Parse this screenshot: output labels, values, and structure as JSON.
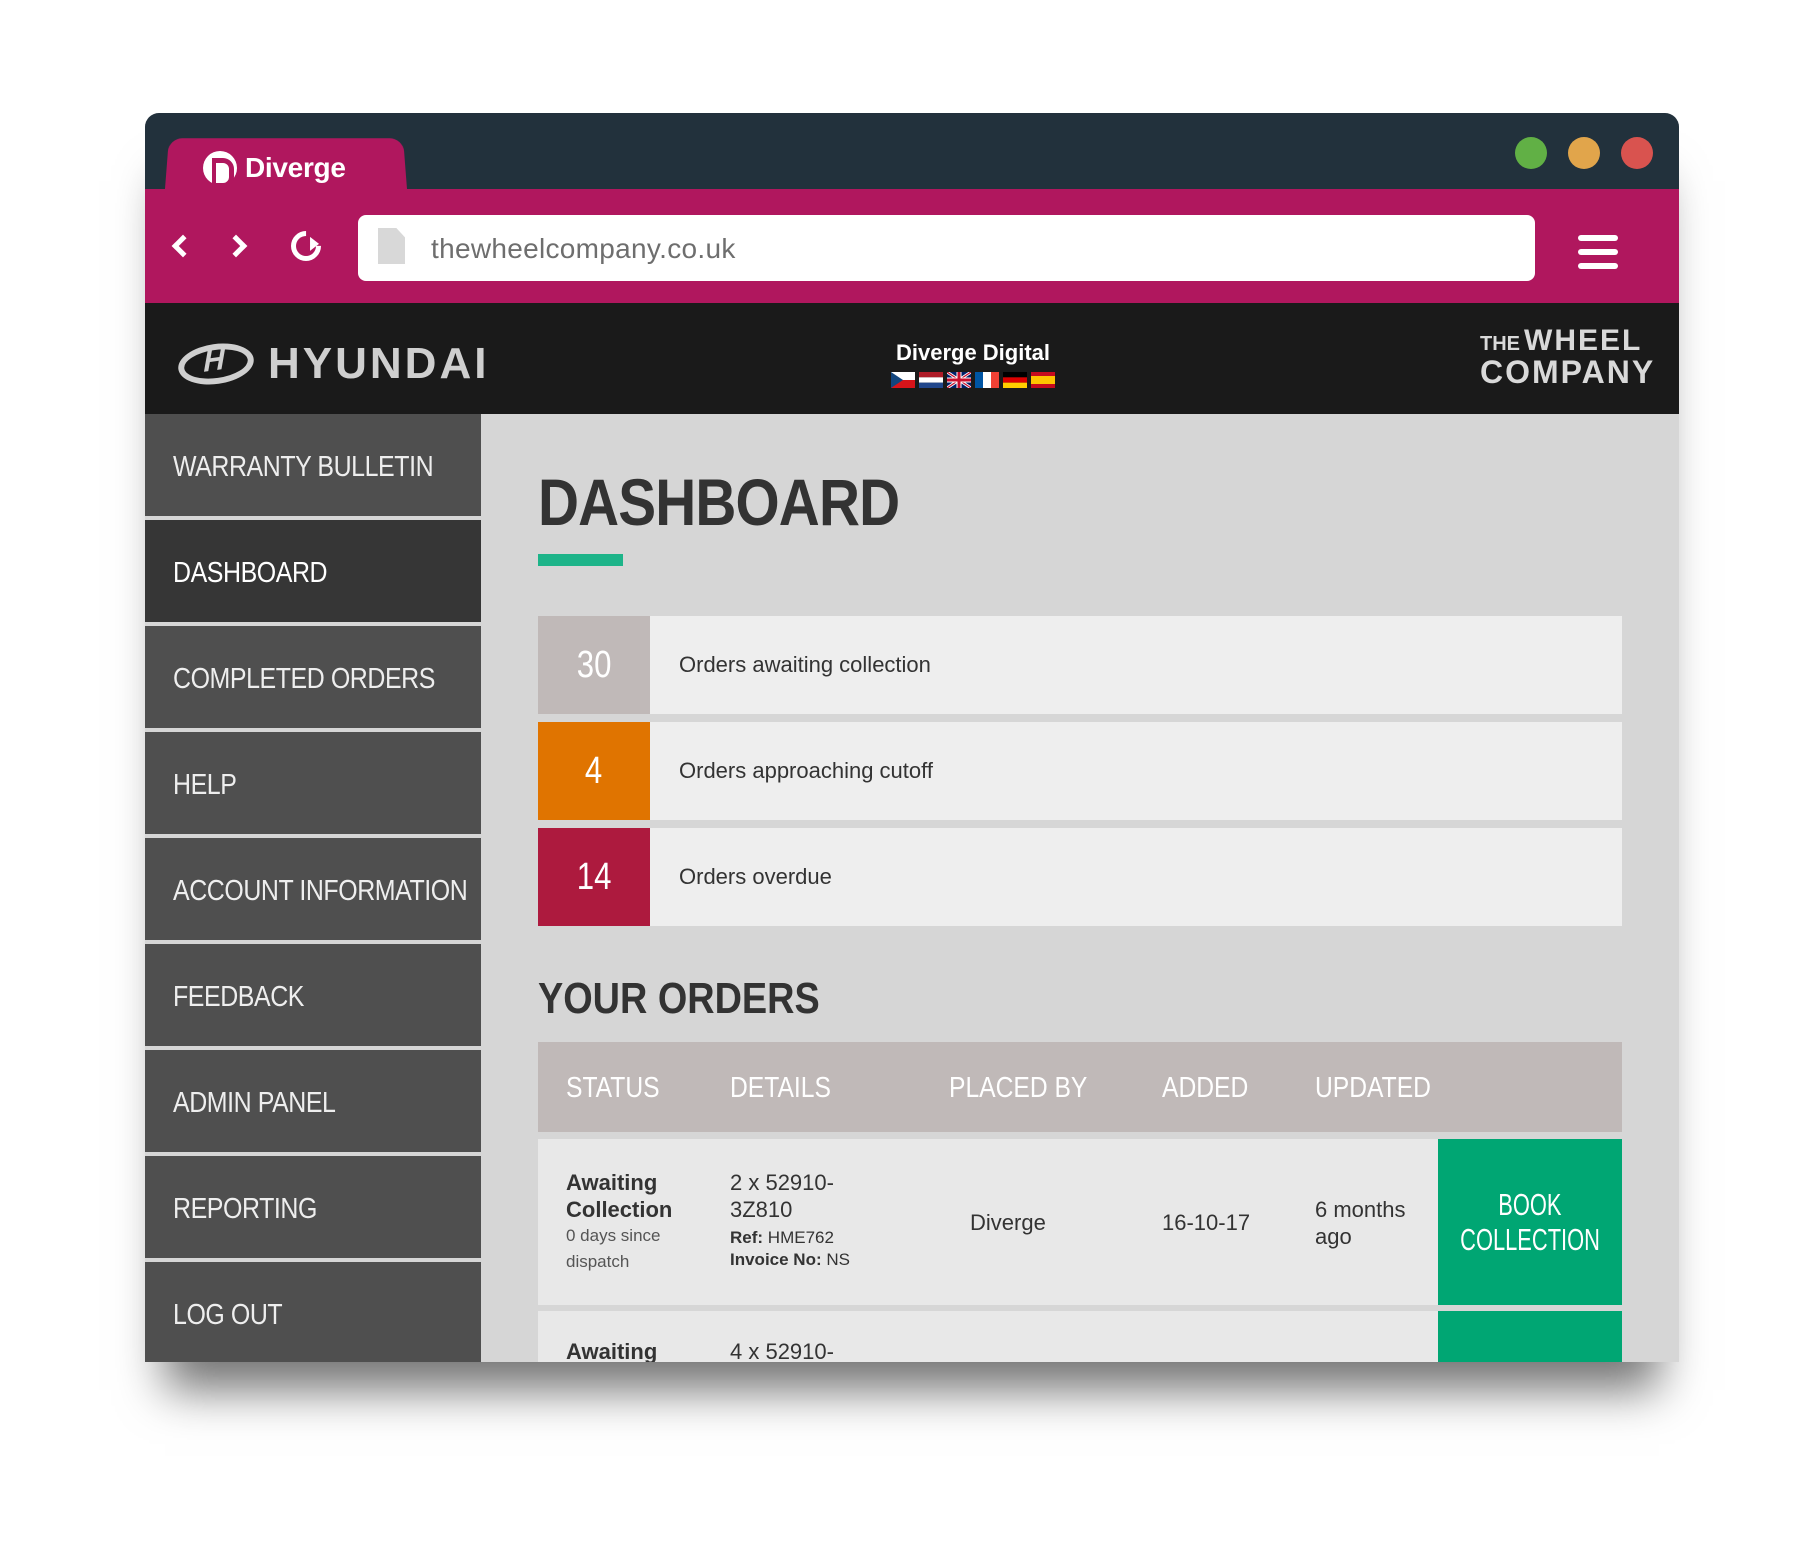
{
  "browser": {
    "tab_title": "Diverge",
    "url": "thewheelcompany.co.uk",
    "colors": {
      "accent": "#b0175e",
      "titlebar": "#22313c"
    }
  },
  "site_header": {
    "left_logo": "HYUNDAI",
    "center_title": "Diverge Digital",
    "right_logo_small": "THE",
    "right_logo_line1": "WHEEL",
    "right_logo_line2": "COMPANY",
    "flags": [
      "czech-flag",
      "netherlands-flag",
      "uk-flag",
      "france-flag",
      "germany-flag",
      "spain-flag"
    ]
  },
  "sidebar": {
    "items": [
      {
        "label": "WARRANTY BULLETIN"
      },
      {
        "label": "DASHBOARD",
        "active": true
      },
      {
        "label": "COMPLETED ORDERS"
      },
      {
        "label": "HELP"
      },
      {
        "label": "ACCOUNT INFORMATION"
      },
      {
        "label": "FEEDBACK"
      },
      {
        "label": "ADMIN PANEL"
      },
      {
        "label": "REPORTING"
      },
      {
        "label": "LOG OUT"
      }
    ]
  },
  "main": {
    "title": "DASHBOARD",
    "stats": [
      {
        "value": "30",
        "label": "Orders awaiting collection",
        "color": "#c0b9b8"
      },
      {
        "value": "4",
        "label": "Orders approaching cutoff",
        "color": "#e07400"
      },
      {
        "value": "14",
        "label": "Orders overdue",
        "color": "#ad1a3e"
      }
    ],
    "orders_title": "YOUR ORDERS",
    "table_headers": [
      "STATUS",
      "DETAILS",
      "PLACED BY",
      "ADDED",
      "UPDATED"
    ],
    "orders": [
      {
        "status_line1": "Awaiting",
        "status_line2": "Collection",
        "status_sub1": "0 days since",
        "status_sub2": "dispatch",
        "details_line1": "2 x 52910-",
        "details_line2": "3Z810",
        "ref_label": "Ref:",
        "ref_value": "HME762",
        "invoice_label": "Invoice No:",
        "invoice_value": "NS",
        "placed_by": "Diverge",
        "added": "16-10-17",
        "updated_line1": "6 months",
        "updated_line2": "ago",
        "action_line1": "BOOK",
        "action_line2": "COLLECTION"
      },
      {
        "status_line1": "Awaiting",
        "details_line1": "4 x 52910-"
      }
    ]
  }
}
